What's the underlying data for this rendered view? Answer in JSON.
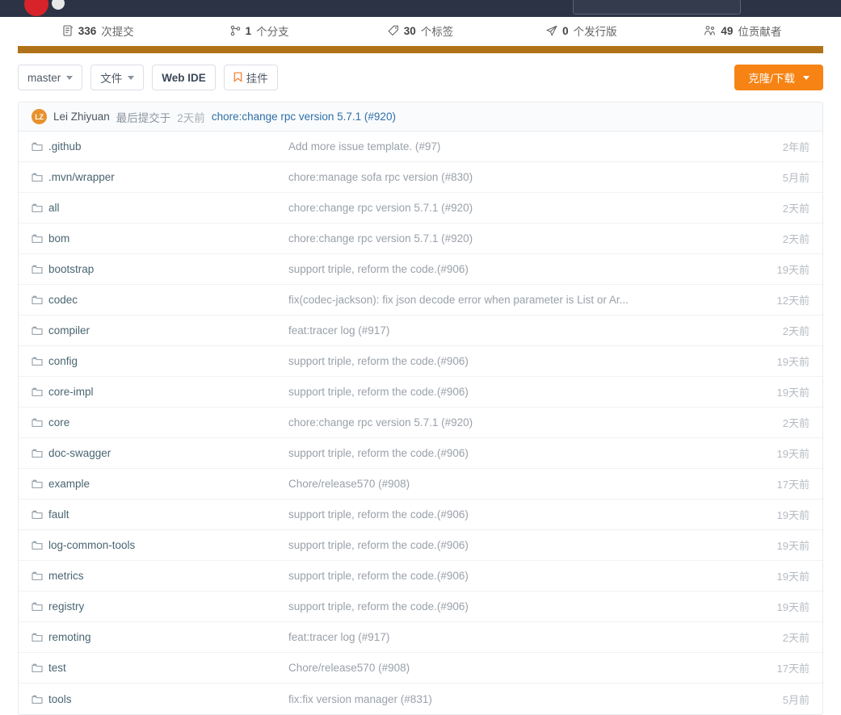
{
  "navbar": {
    "logo_icon": "gitee-logo-icon",
    "search_placeholder": "",
    "search_value": ""
  },
  "stats": [
    {
      "icon": "commit-list-icon",
      "count": "336",
      "label": "次提交"
    },
    {
      "icon": "branch-icon",
      "count": "1",
      "label": "个分支"
    },
    {
      "icon": "tag-icon",
      "count": "30",
      "label": "个标签"
    },
    {
      "icon": "release-icon",
      "count": "0",
      "label": "个发行版"
    },
    {
      "icon": "contributors-icon",
      "count": "49",
      "label": "位贡献者"
    }
  ],
  "language_bar": {
    "color": "#b07219",
    "segments": [
      {
        "color": "#b07219",
        "percent": 100
      }
    ]
  },
  "toolbar": {
    "branch_label": "master",
    "files_label": "文件",
    "webide_label": "Web IDE",
    "widget_label": "挂件",
    "widget_icon": "bookmark-icon",
    "clone_label": "克隆/下载",
    "clone_color": "#f68313"
  },
  "commit_bar": {
    "avatar_initials": "LZ",
    "avatar_color": "#e8912d",
    "author": "Lei Zhiyuan",
    "separator": "最后提交于",
    "time": "2天前",
    "message": "chore:change rpc version 5.7.1 (#920)"
  },
  "files": [
    {
      "icon": "folder-icon",
      "name": ".github",
      "message": "Add more issue template. (#97)",
      "age": "2年前"
    },
    {
      "icon": "folder-icon",
      "name": ".mvn/wrapper",
      "message": "chore:manage sofa rpc version (#830)",
      "age": "5月前"
    },
    {
      "icon": "folder-icon",
      "name": "all",
      "message": "chore:change rpc version 5.7.1 (#920)",
      "age": "2天前"
    },
    {
      "icon": "folder-icon",
      "name": "bom",
      "message": "chore:change rpc version 5.7.1 (#920)",
      "age": "2天前"
    },
    {
      "icon": "folder-icon",
      "name": "bootstrap",
      "message": "support triple, reform the code.(#906)",
      "age": "19天前"
    },
    {
      "icon": "folder-icon",
      "name": "codec",
      "message": "fix(codec-jackson): fix json decode error when parameter is List or Ar...",
      "age": "12天前"
    },
    {
      "icon": "folder-icon",
      "name": "compiler",
      "message": "feat:tracer log (#917)",
      "age": "2天前"
    },
    {
      "icon": "folder-icon",
      "name": "config",
      "message": "support triple, reform the code.(#906)",
      "age": "19天前"
    },
    {
      "icon": "folder-icon",
      "name": "core-impl",
      "message": "support triple, reform the code.(#906)",
      "age": "19天前"
    },
    {
      "icon": "folder-icon",
      "name": "core",
      "message": "chore:change rpc version 5.7.1 (#920)",
      "age": "2天前"
    },
    {
      "icon": "folder-icon",
      "name": "doc-swagger",
      "message": "support triple, reform the code.(#906)",
      "age": "19天前"
    },
    {
      "icon": "folder-icon",
      "name": "example",
      "message": "Chore/release570 (#908)",
      "age": "17天前"
    },
    {
      "icon": "folder-icon",
      "name": "fault",
      "message": "support triple, reform the code.(#906)",
      "age": "19天前"
    },
    {
      "icon": "folder-icon",
      "name": "log-common-tools",
      "message": "support triple, reform the code.(#906)",
      "age": "19天前"
    },
    {
      "icon": "folder-icon",
      "name": "metrics",
      "message": "support triple, reform the code.(#906)",
      "age": "19天前"
    },
    {
      "icon": "folder-icon",
      "name": "registry",
      "message": "support triple, reform the code.(#906)",
      "age": "19天前"
    },
    {
      "icon": "folder-icon",
      "name": "remoting",
      "message": "feat:tracer log (#917)",
      "age": "2天前"
    },
    {
      "icon": "folder-icon",
      "name": "test",
      "message": "Chore/release570 (#908)",
      "age": "17天前"
    },
    {
      "icon": "folder-icon",
      "name": "tools",
      "message": "fix:fix version manager (#831)",
      "age": "5月前"
    }
  ]
}
